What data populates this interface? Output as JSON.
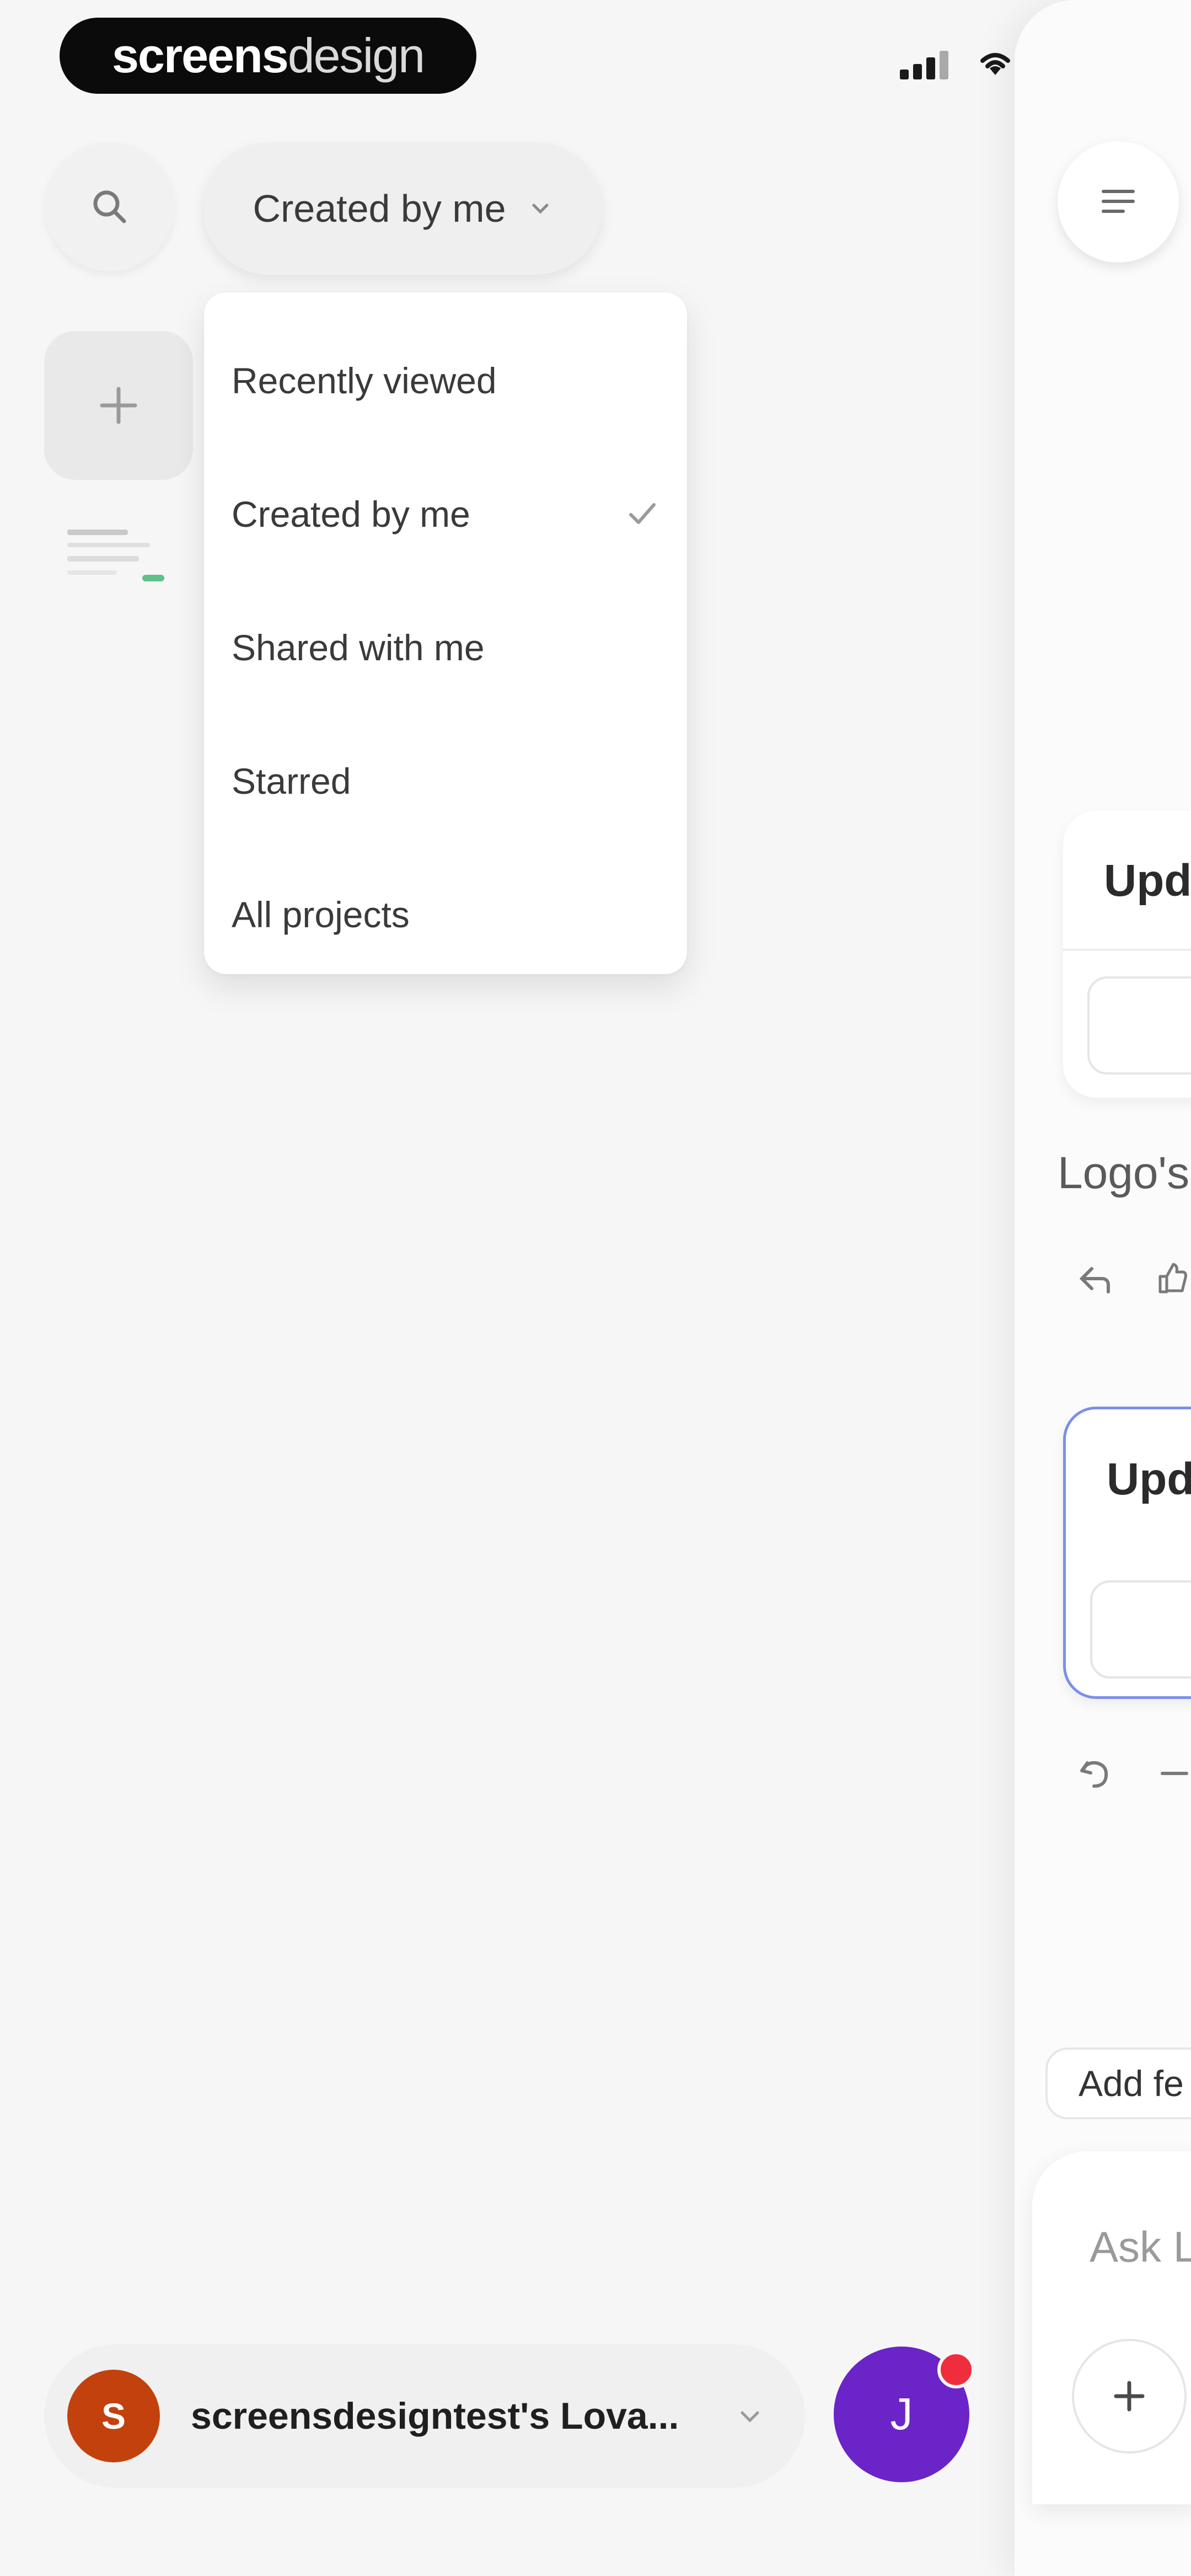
{
  "brand": {
    "bold": "screens",
    "light": "design"
  },
  "filter": {
    "selected": "Created by me"
  },
  "menu": {
    "items": [
      {
        "label": "Recently viewed",
        "checked": false
      },
      {
        "label": "Created by me",
        "checked": true
      },
      {
        "label": "Shared with me",
        "checked": false
      },
      {
        "label": "Starred",
        "checked": false
      },
      {
        "label": "All projects",
        "checked": false
      }
    ]
  },
  "account": {
    "initial": "S",
    "name": "screensdesigntest's Lova..."
  },
  "user": {
    "initial": "J"
  },
  "panel": {
    "card1_title": "Upd",
    "caption": "Logo's",
    "card2_title": "Upd",
    "add_chip": "Add fe",
    "ask_placeholder": "Ask L"
  },
  "colors": {
    "account_avatar": "#c2410c",
    "user_avatar": "#6a24c8",
    "notification": "#ef2d3d",
    "card_focus_border": "#7b8fe8"
  }
}
